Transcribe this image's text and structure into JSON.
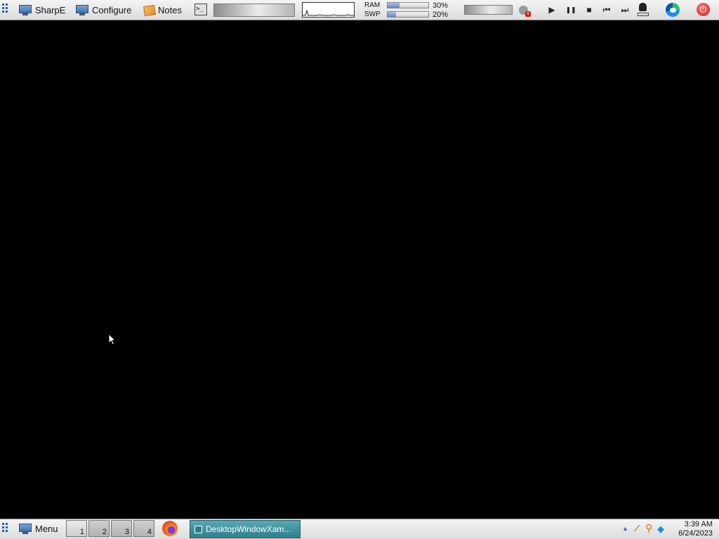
{
  "topbar": {
    "launchers": [
      {
        "label": "SharpE",
        "icon": "monitor-icon"
      },
      {
        "label": "Configure",
        "icon": "monitor-icon"
      },
      {
        "label": "Notes",
        "icon": "notes-icon"
      }
    ],
    "terminal_glyph": ">_",
    "meters": {
      "ram_label": "RAM",
      "ram_percent": "30%",
      "ram_fraction": 0.3,
      "swap_label": "SWP",
      "swap_percent": "20%",
      "swap_fraction": 0.2
    },
    "media_controls": [
      "play-icon",
      "pause-icon",
      "stop-icon",
      "previous-icon",
      "next-icon"
    ],
    "media_glyphs": {
      "play": "▶",
      "pause": "❚❚",
      "stop": "■",
      "previous": "⏮",
      "next": "⏭"
    },
    "power_glyph": "⏻"
  },
  "bottombar": {
    "menu_label": "Menu",
    "workspaces": [
      "1",
      "2",
      "3",
      "4"
    ],
    "active_workspace": "1",
    "task_label": "DesktopWindowXam...",
    "clock": {
      "time": "3:39 AM",
      "date": "6/24/2023"
    },
    "tray_icons": [
      "tray-expand-icon",
      "network-icon",
      "search-icon",
      "cube-icon"
    ],
    "tray_glyphs": {
      "expand": "▲",
      "network": "⟋",
      "search": "⚲",
      "cube": "◆"
    }
  },
  "colors": {
    "desktop": "#000000",
    "bar": "#e6e6e6",
    "task_active": "#3c8e9a",
    "accent": "#2b5fa8",
    "power": "#d11a1a"
  }
}
